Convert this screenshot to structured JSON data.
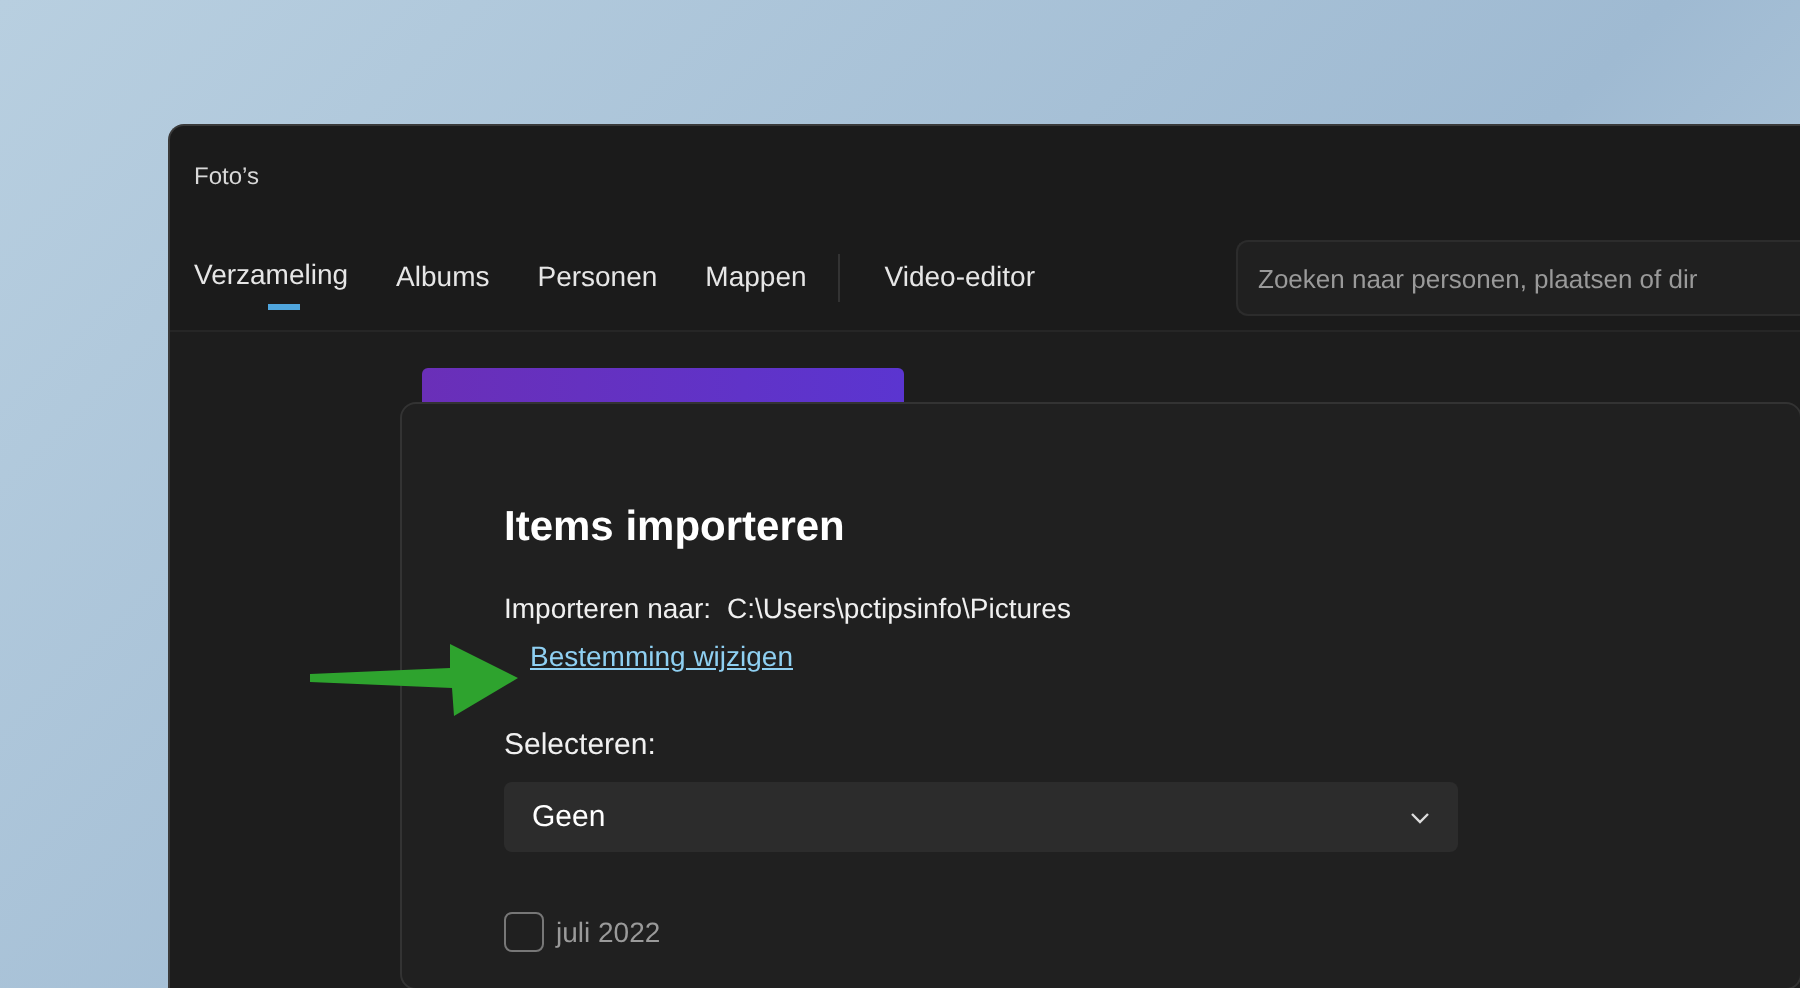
{
  "window": {
    "title": "Foto’s"
  },
  "tabs": [
    {
      "label": "Verzameling",
      "selected": true,
      "separator_before": false
    },
    {
      "label": "Albums",
      "selected": false,
      "separator_before": false
    },
    {
      "label": "Personen",
      "selected": false,
      "separator_before": false
    },
    {
      "label": "Mappen",
      "selected": false,
      "separator_before": false
    },
    {
      "label": "Video-editor",
      "selected": false,
      "separator_before": true
    }
  ],
  "search": {
    "placeholder": "Zoeken naar personen, plaatsen of dir"
  },
  "dialog": {
    "title": "Items importeren",
    "destination_label": "Importeren naar:",
    "destination_path": "C:\\Users\\pctipsinfo\\Pictures",
    "change_link": "Bestemming wijzigen",
    "select_label": "Selecteren:",
    "select_value": "Geen",
    "groups": [
      {
        "label": "juli 2022",
        "checked": false
      }
    ]
  }
}
